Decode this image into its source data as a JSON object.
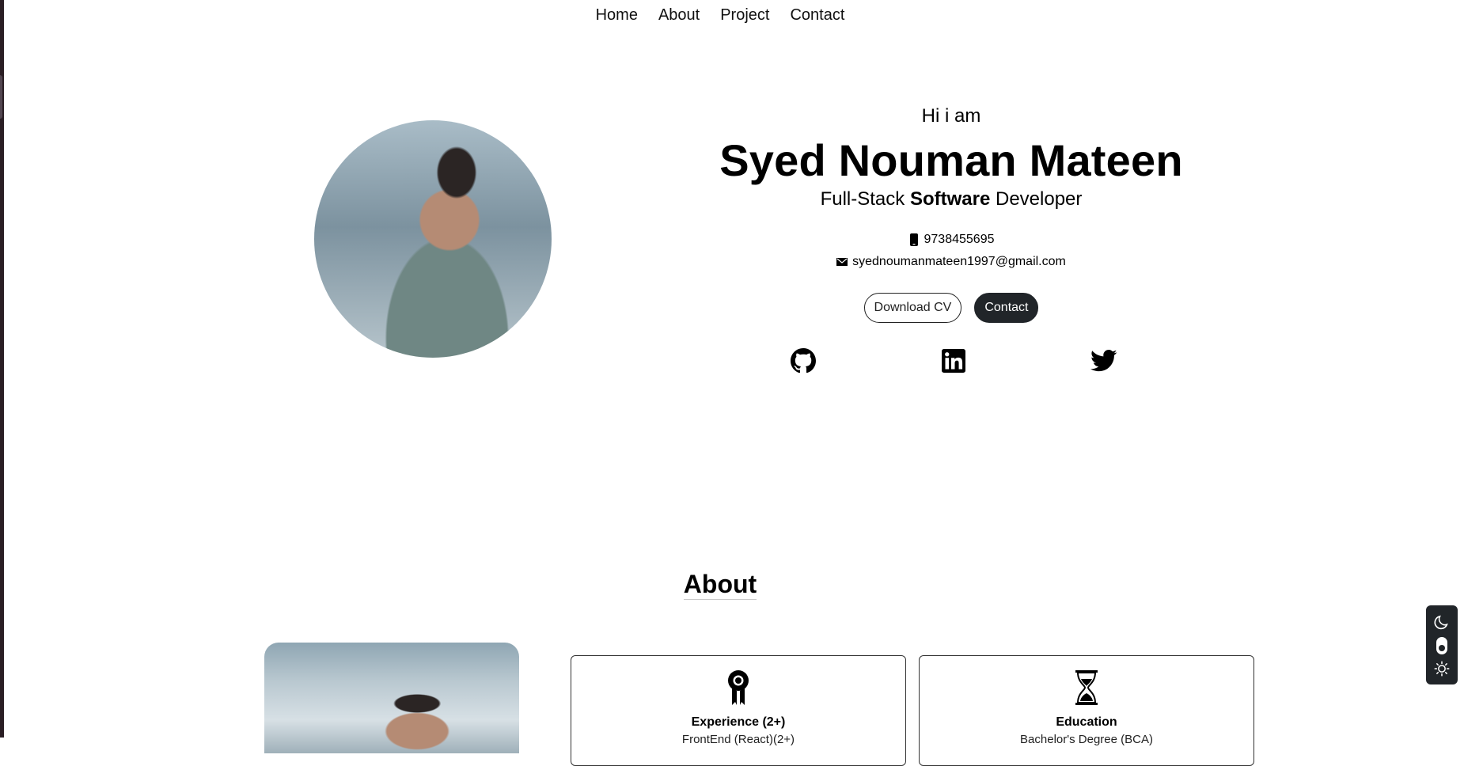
{
  "nav": {
    "items": [
      {
        "label": "Home"
      },
      {
        "label": "About"
      },
      {
        "label": "Project"
      },
      {
        "label": "Contact"
      }
    ]
  },
  "hero": {
    "greeting": "Hi i am",
    "name": "Syed Nouman Mateen",
    "role_prefix": "Full-Stack",
    "role_emphasis": "Software",
    "role_suffix": "Developer",
    "phone": "9738455695",
    "email": "syednoumanmateen1997@gmail.com",
    "download_cv_label": "Download CV",
    "contact_label": "Contact",
    "socials": [
      {
        "name": "github",
        "icon": "github-icon"
      },
      {
        "name": "linkedin",
        "icon": "linkedin-icon"
      },
      {
        "name": "twitter",
        "icon": "twitter-icon"
      }
    ]
  },
  "about": {
    "title": "About",
    "cards": [
      {
        "icon": "award-icon",
        "title": "Experience (2+)",
        "subtitle": "FrontEnd (React)(2+)"
      },
      {
        "icon": "hourglass-icon",
        "title": "Education",
        "subtitle": "Bachelor's Degree (BCA)"
      }
    ]
  },
  "theme_switch": {
    "icons": [
      "moon-icon",
      "toggle-icon",
      "sun-icon"
    ]
  }
}
